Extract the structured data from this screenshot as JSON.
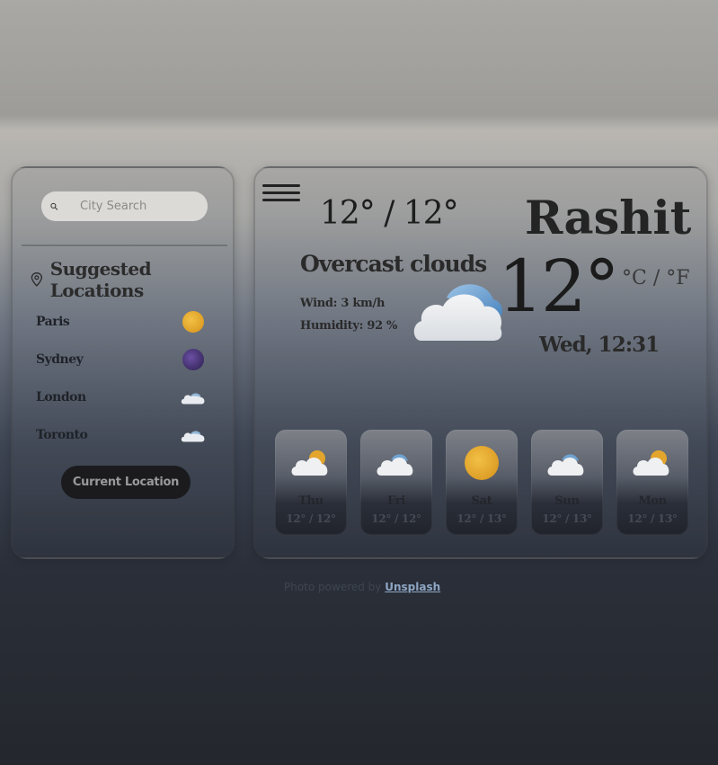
{
  "search": {
    "placeholder": "City Search"
  },
  "suggested": {
    "title": "Suggested Locations",
    "items": [
      {
        "name": "Paris",
        "icon": "sun-icon"
      },
      {
        "name": "Sydney",
        "icon": "moon-icon"
      },
      {
        "name": "London",
        "icon": "cloud-icon"
      },
      {
        "name": "Toronto",
        "icon": "cloud-icon"
      }
    ],
    "current_button": "Current Location"
  },
  "weather": {
    "hi_lo": "12° / 12°",
    "description": "Overcast clouds",
    "wind": "Wind: 3 km/h",
    "humidity": "Humidity: 92 %",
    "city": "Rashit",
    "temperature": "12°",
    "unit_c": "°C",
    "unit_sep": " / ",
    "unit_f": "°F",
    "datetime": "Wed, 12:31",
    "main_icon": "cloud-icon"
  },
  "forecast": [
    {
      "day": "Thu",
      "temp": "12° / 12°",
      "icon": "cloud-sun-icon"
    },
    {
      "day": "Fri",
      "temp": "12° / 12°",
      "icon": "cloud-icon"
    },
    {
      "day": "Sat",
      "temp": "12° / 13°",
      "icon": "sun-icon"
    },
    {
      "day": "Sun",
      "temp": "12° / 13°",
      "icon": "cloud-icon"
    },
    {
      "day": "Mon",
      "temp": "12° / 13°",
      "icon": "cloud-sun-icon"
    }
  ],
  "footer": {
    "text": "Photo powered by ",
    "link": "Unsplash"
  },
  "colors": {
    "sun": "#e3a52c",
    "moon": "#3b2a6b",
    "button_bg": "#1b1b1e"
  }
}
